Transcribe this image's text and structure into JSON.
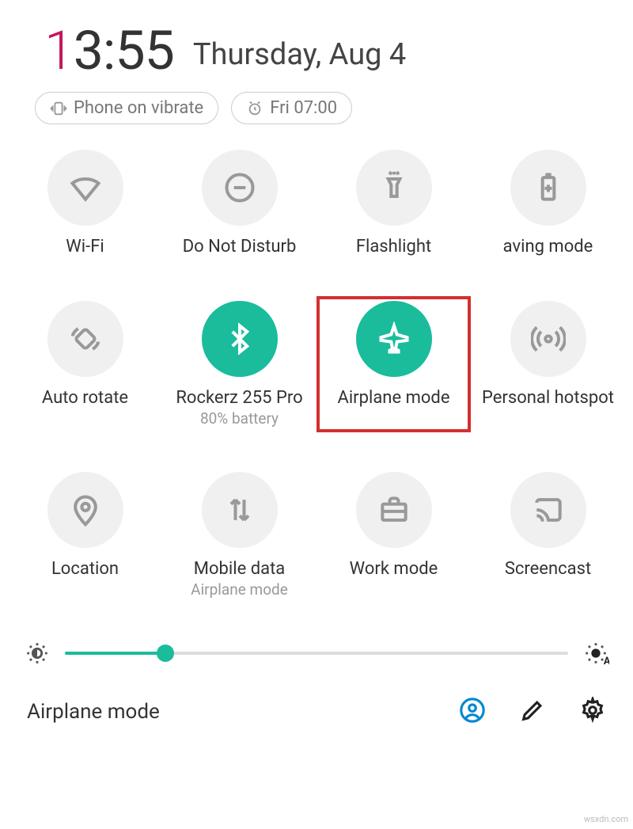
{
  "header": {
    "time_hour_first": "1",
    "time_rest": "3:55",
    "date": "Thursday, Aug 4"
  },
  "chips": {
    "vibrate": "Phone on vibrate",
    "alarm": "Fri 07:00"
  },
  "tiles": {
    "wifi": "Wi-Fi",
    "dnd": "Do Not Disturb",
    "flashlight": "Flashlight",
    "saving": "aving mode",
    "autorotate": "Auto rotate",
    "bluetooth": "Rockerz 255 Pro",
    "bluetooth_sub": "80% battery",
    "airplane": "Airplane mode",
    "hotspot": "Personal hotspot",
    "location": "Location",
    "mobiledata": "Mobile data",
    "mobiledata_sub": "Airplane mode",
    "workmode": "Work mode",
    "screencast": "Screencast"
  },
  "brightness": {
    "percent": 20
  },
  "footer": {
    "title": "Airplane mode"
  },
  "watermark": "wsxdn.com"
}
